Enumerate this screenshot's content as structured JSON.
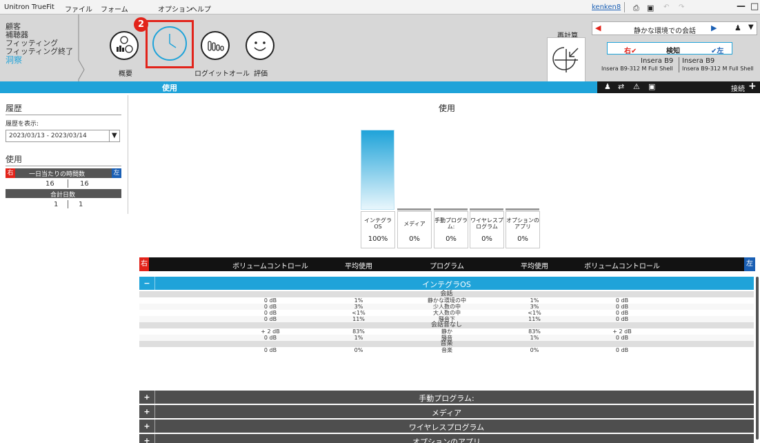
{
  "menubar": {
    "app": "Unitron TrueFit",
    "file": "ファイル",
    "form": "フォーム",
    "option": "オプション",
    "help": "ヘルプ",
    "user": "kenken8"
  },
  "nav": {
    "items": [
      "顧客",
      "補聴器",
      "フィッティング",
      "フィッティング終了",
      "洞察"
    ],
    "icons": [
      "概要",
      "",
      "ログイットオール",
      "評価"
    ],
    "recalc": "再計算",
    "section": "使用",
    "step_badge": "2"
  },
  "device": {
    "environment": "静かな環境での会話",
    "right": "右",
    "detect": "検知",
    "left": "左",
    "model_r": "Insera B9",
    "model_l": "Insera B9",
    "shell_r": "Insera B9-312 M Full Shell",
    "shell_l": "Insera B9-312 M Full Shell",
    "connect": "接続"
  },
  "sidebar": {
    "history_title": "履歴",
    "show_history": "履歴を表示:",
    "date_range": "2023/03/13 - 2023/03/14",
    "usage_title": "使用",
    "right": "右",
    "left": "左",
    "hours_per_day": "一日当たりの時間数",
    "hours_r": "16",
    "hours_l": "16",
    "total_days": "合計日数",
    "days_r": "1",
    "days_l": "1"
  },
  "chart_data": {
    "type": "bar",
    "title": "使用",
    "categories": [
      "インテグラOS",
      "メディア",
      "手動プログラム:",
      "ワイヤレスプログラム",
      "オプションのアプリ"
    ],
    "values": [
      100,
      0,
      0,
      0,
      0
    ],
    "value_labels": [
      "100%",
      "0%",
      "0%",
      "0%",
      "0%"
    ],
    "ylim": [
      0,
      100
    ],
    "bar_color": "#1fa3d9"
  },
  "table": {
    "right": "右",
    "left": "左",
    "headers": [
      "ボリュームコントロール",
      "平均使用",
      "プログラム",
      "平均使用",
      "ボリュームコントロール"
    ],
    "expanded_group": "インテグラOS",
    "sections": [
      {
        "title": "会話",
        "rows": [
          [
            "0 dB",
            "1%",
            "静かな環境の中",
            "1%",
            "0 dB"
          ],
          [
            "0 dB",
            "3%",
            "少人数の中",
            "3%",
            "0 dB"
          ],
          [
            "0 dB",
            "<1%",
            "大人数の中",
            "<1%",
            "0 dB"
          ],
          [
            "0 dB",
            "11%",
            "騒音下",
            "11%",
            "0 dB"
          ]
        ]
      },
      {
        "title": "会話音なし",
        "rows": [
          [
            "+ 2 dB",
            "83%",
            "静か",
            "83%",
            "+ 2 dB"
          ],
          [
            "0 dB",
            "1%",
            "騒音",
            "1%",
            "0 dB"
          ]
        ]
      },
      {
        "title": "音楽",
        "rows": [
          [
            "0 dB",
            "0%",
            "音楽",
            "0%",
            "0 dB"
          ]
        ]
      }
    ],
    "collapsed_groups": [
      "手動プログラム:",
      "メディア",
      "ワイヤレスプログラム",
      "オプションのアプリ"
    ],
    "minus": "−",
    "plus": "+"
  }
}
